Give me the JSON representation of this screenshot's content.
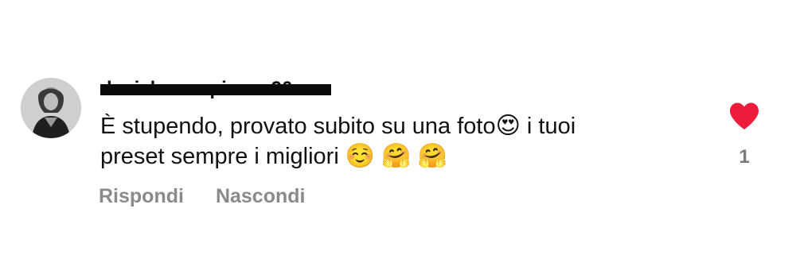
{
  "comment": {
    "username": "daniela.campisano90",
    "username_redacted": true,
    "text_line_1": "È stupendo, provato subito su una foto",
    "emoji_1": "😍",
    "text_line_1_end": "i tuoi",
    "text_line_2": "preset sempre i migliori",
    "emoji_2": "☺️",
    "emoji_3": "🤗",
    "emoji_4": "🤗",
    "reply_label": "Rispondi",
    "hide_label": "Nascondi",
    "like_count": "1",
    "liked": true,
    "like_color": "#ed1c3b",
    "avatar_icon": "profile-photo"
  }
}
